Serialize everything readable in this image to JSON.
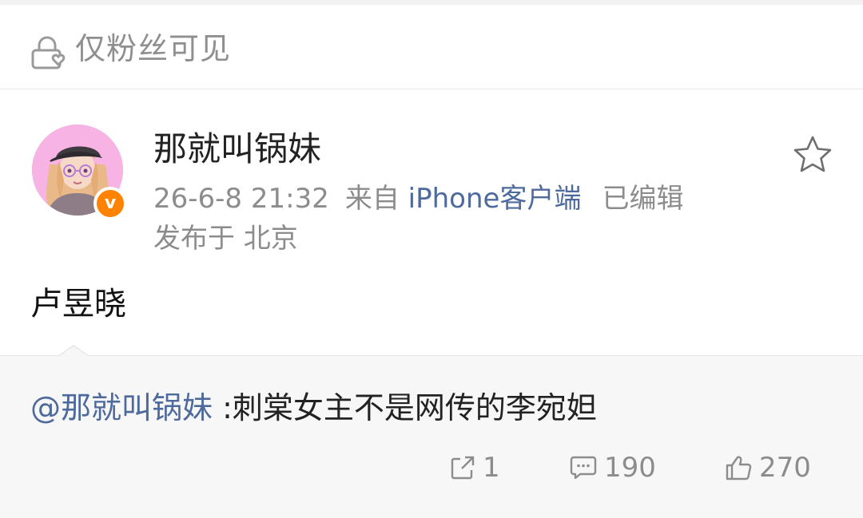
{
  "visibility": {
    "icon": "lock-heart-icon",
    "label": "仅粉丝可见"
  },
  "post": {
    "author": {
      "name": "那就叫锅妹",
      "avatar": "avatar-illustration",
      "verified_badge": "v",
      "badge_color": "#ff8200"
    },
    "meta": {
      "time": "26-6-8 21:32",
      "source_prefix": "来自",
      "source": "iPhone客户端",
      "edited": "已编辑",
      "location": "发布于 北京"
    },
    "text": "卢昱晓",
    "favorite_icon": "star-outline-icon"
  },
  "repost": {
    "mention": "@那就叫锅妹",
    "text": " :刺棠女主不是网传的李宛妲"
  },
  "actions": {
    "repost_count": "1",
    "comment_count": "190",
    "like_count": "270"
  },
  "colors": {
    "link": "#4e6a9c",
    "muted": "#8c8c8c",
    "card_bg": "#f7f7f7"
  }
}
